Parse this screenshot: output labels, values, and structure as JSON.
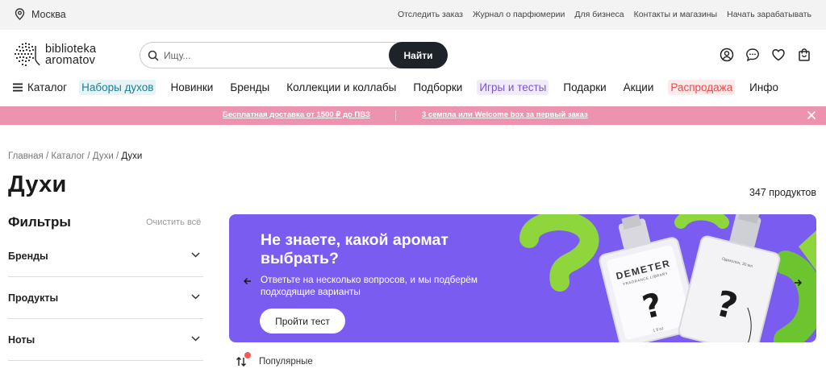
{
  "topbar": {
    "city": "Москва",
    "links": [
      "Отследить заказ",
      "Журнал о парфюмерии",
      "Для бизнеса",
      "Контакты и магазины",
      "Начать зарабатывать"
    ]
  },
  "header": {
    "logo_line1": "biblioteka",
    "logo_line2": "aromatov",
    "search_placeholder": "Ищу...",
    "search_button": "Найти",
    "icons": [
      "user-icon",
      "chat-icon",
      "heart-icon",
      "bag-icon"
    ]
  },
  "nav": {
    "catalog": "Каталог",
    "items": [
      "Наборы духов",
      "Новинки",
      "Бренды",
      "Коллекции и коллабы",
      "Подборки",
      "Игры и тесты",
      "Подарки",
      "Акции",
      "Распродажа",
      "Инфо"
    ]
  },
  "promo": {
    "left": "Бесплатная доставка от 1500 ₽ до ПВЗ",
    "right": "3 семпла или Welcome box за первый заказ",
    "color": "#ed93b0"
  },
  "breadcrumbs": {
    "items": [
      "Главная",
      "Каталог",
      "Духи"
    ],
    "current": "Духи",
    "separator": " / "
  },
  "page": {
    "title": "Духи",
    "count": "347 продуктов"
  },
  "filters": {
    "title": "Фильтры",
    "clear": "Очистить всё",
    "groups": [
      "Бренды",
      "Продукты",
      "Ноты"
    ]
  },
  "banner": {
    "title": "Не знаете, какой аромат выбрать?",
    "subtitle": "Ответьте на несколько вопросов, и мы подберём подходящие варианты",
    "button": "Пройти тест",
    "bottle1_brand": "DEMETER",
    "bottle1_sub": "FRAGRANCE LIBRARY",
    "bottle1_vol": "1 fl oz",
    "bottle2_vol": "Одеколон, 30 мл",
    "color": "#7b5cf0"
  },
  "sort": {
    "label": "Популярные"
  }
}
